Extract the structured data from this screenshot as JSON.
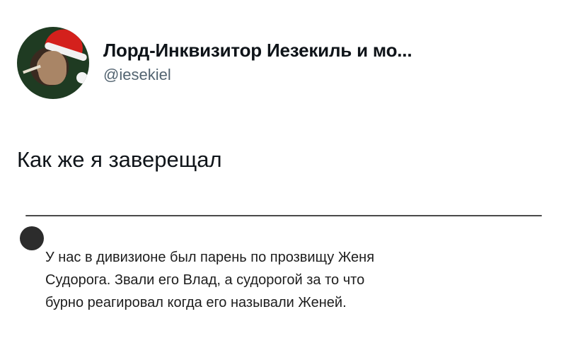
{
  "post": {
    "author": {
      "display_name": "Лорд-Инквизитор Иезекиль и мо...",
      "handle": "@iesekiel",
      "avatar_icon": "user-avatar-santa-hat"
    },
    "text": "Как же я заверещал"
  },
  "media": {
    "comment": {
      "author": "",
      "avatar_icon": "commenter-avatar",
      "lines": [
        "У нас в дивизионе был парень по прозвищу Женя",
        "Судорога. Звали его Влад, а судорогой за то что",
        "бурно реагировал когда его называли Женей."
      ]
    }
  }
}
